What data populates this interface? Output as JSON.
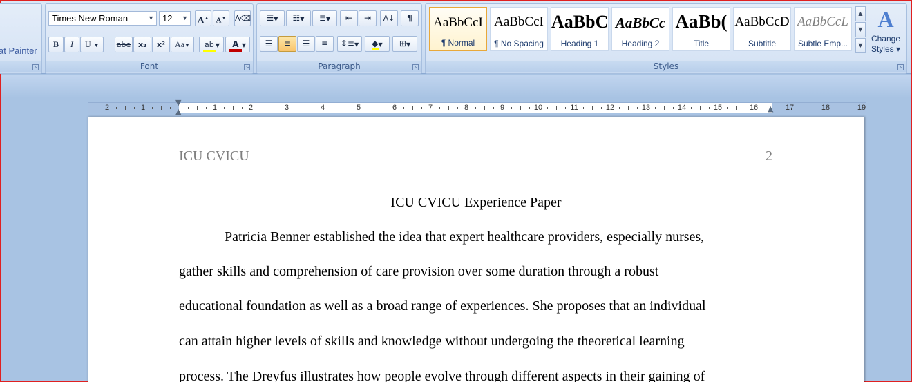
{
  "clipboard": {
    "format_painter_label": "at Painter"
  },
  "font": {
    "group_label": "Font",
    "font_name": "Times New Roman",
    "font_size": "12",
    "grow_label": "A",
    "shrink_label": "A",
    "bold": "B",
    "italic": "I",
    "underline": "U",
    "strikethrough": "abe",
    "subscript": "x₂",
    "superscript": "x²",
    "change_case": "Aa",
    "highlight_color": "#ffff00",
    "font_color": "#c00000"
  },
  "paragraph": {
    "group_label": "Paragraph",
    "show_marks": "¶"
  },
  "styles": {
    "group_label": "Styles",
    "items": [
      {
        "sample": "AaBbCcI",
        "name": "¶ Normal",
        "selected": true
      },
      {
        "sample": "AaBbCcI",
        "name": "¶ No Spacing"
      },
      {
        "sample": "AaBbC",
        "name": "Heading 1"
      },
      {
        "sample": "AaBbCc",
        "name": "Heading 2"
      },
      {
        "sample": "AaBb(",
        "name": "Title"
      },
      {
        "sample": "AaBbCcD",
        "name": "Subtitle"
      },
      {
        "sample": "AaBbCcL",
        "name": "Subtle Emp..."
      }
    ],
    "change_styles": {
      "line1": "Change",
      "line2": "Styles ▾"
    }
  },
  "ruler": {
    "numbers": [
      "2",
      "1",
      "",
      "1",
      "2",
      "3",
      "4",
      "5",
      "6",
      "7",
      "8",
      "9",
      "10",
      "11",
      "12",
      "13",
      "14",
      "15",
      "16",
      "17",
      "18",
      "19"
    ]
  },
  "document": {
    "header_left": "ICU CVICU",
    "page_number": "2",
    "title": "ICU CVICU Experience Paper",
    "lines": [
      "Patricia Benner established the idea that expert healthcare providers, especially nurses,",
      "gather skills and comprehension of care provision over some duration through a robust",
      "educational foundation as well as a broad range of experiences. She proposes that an individual",
      "can attain higher levels of skills and knowledge without undergoing the theoretical learning",
      "process. The Dreyfus illustrates how people evolve through different aspects in their gaining of"
    ]
  }
}
